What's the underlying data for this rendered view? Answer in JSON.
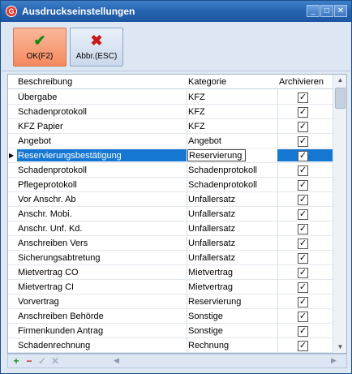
{
  "window": {
    "title": "Ausdruckseinstellungen",
    "app_icon_letter": "G",
    "minimize_glyph": "_",
    "maximize_glyph": "□",
    "close_glyph": "✕"
  },
  "toolbar": {
    "ok_icon": "✔",
    "ok_label": "OK(F2)",
    "cancel_icon": "✖",
    "cancel_label": "Abbr.(ESC)"
  },
  "table": {
    "headers": {
      "description": "Beschreibung",
      "category": "Kategorie",
      "archive": "Archivieren"
    },
    "rows": [
      {
        "description": "Übergabe",
        "category": "KFZ",
        "archive": true
      },
      {
        "description": "Schadenprotokoll",
        "category": "KFZ",
        "archive": true
      },
      {
        "description": "KFZ Papier",
        "category": "KFZ",
        "archive": true
      },
      {
        "description": "Angebot",
        "category": "Angebot",
        "archive": true
      },
      {
        "description": "Reservierungsbestätigung",
        "category": "Reservierung",
        "archive": true,
        "selected": true
      },
      {
        "description": "Schadenprotokoll",
        "category": "Schadenprotokoll",
        "archive": true
      },
      {
        "description": "Pflegeprotokoll",
        "category": "Schadenprotokoll",
        "archive": true
      },
      {
        "description": "Vor Anschr. Ab",
        "category": "Unfallersatz",
        "archive": true
      },
      {
        "description": "Anschr. Mobi.",
        "category": "Unfallersatz",
        "archive": true
      },
      {
        "description": "Anschr. Unf. Kd.",
        "category": "Unfallersatz",
        "archive": true
      },
      {
        "description": "Anschreiben Vers",
        "category": "Unfallersatz",
        "archive": true
      },
      {
        "description": "Sicherungsabtretung",
        "category": "Unfallersatz",
        "archive": true
      },
      {
        "description": "Mietvertrag CO",
        "category": "Mietvertrag",
        "archive": true
      },
      {
        "description": "Mietvertrag CI",
        "category": "Mietvertrag",
        "archive": true
      },
      {
        "description": "Vorvertrag",
        "category": "Reservierung",
        "archive": true
      },
      {
        "description": "Anschreiben Behörde",
        "category": "Sonstige",
        "archive": true
      },
      {
        "description": "Firmenkunden Antrag",
        "category": "Sonstige",
        "archive": true
      },
      {
        "description": "Schadenrechnung",
        "category": "Rechnung",
        "archive": true
      }
    ],
    "checkmark": "✓",
    "row_indicator": "▶"
  },
  "scrollbar": {
    "up_glyph": "▲",
    "down_glyph": "▼"
  },
  "statusbar": {
    "add_glyph": "+",
    "delete_glyph": "−",
    "confirm_glyph": "✓",
    "cancel_glyph": "✕",
    "left_arrow": "◀",
    "right_arrow": "▶"
  },
  "colors": {
    "title_bar": "#2563b0",
    "ok_button": "#f4895f",
    "selection": "#1677d2"
  }
}
